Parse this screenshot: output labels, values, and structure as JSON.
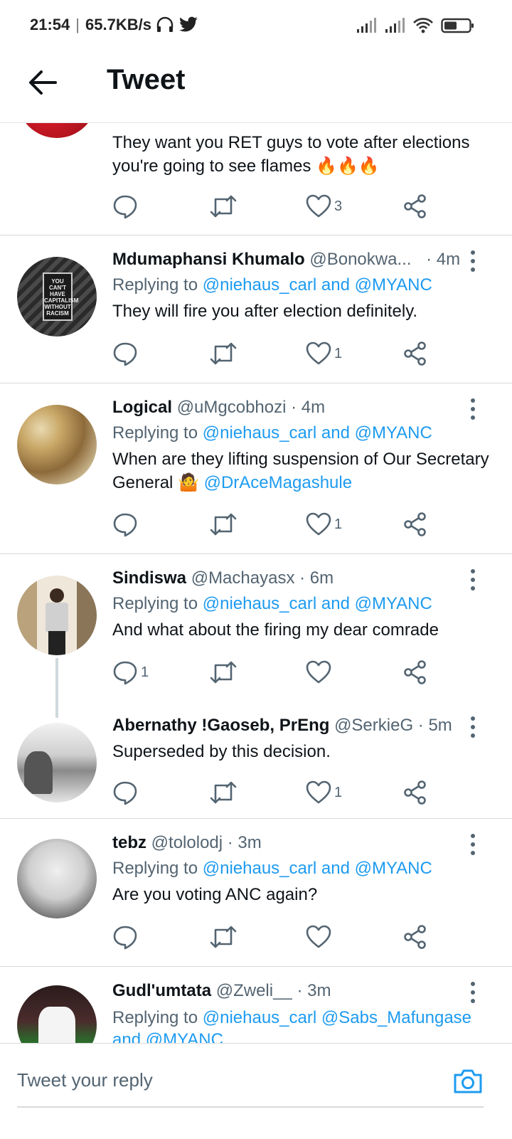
{
  "status": {
    "time": "21:54",
    "speed": "65.7KB/s"
  },
  "header": {
    "title": "Tweet"
  },
  "tweets": [
    {
      "text": "They want you RET guys to vote after elections you're going to see flames 🔥🔥🔥",
      "likes": "3"
    },
    {
      "name": "Mdumaphansi Khumalo",
      "handle": "@Bonokwa...",
      "time": "· 4m",
      "reply_prefix": "Replying to ",
      "reply_to": "@niehaus_carl and @MYANC",
      "text": "They will fire you after election definitely.",
      "likes": "1"
    },
    {
      "name": "Logical",
      "handle": "@uMgcobhozi",
      "time": "· 4m",
      "reply_prefix": "Replying to ",
      "reply_to": "@niehaus_carl and @MYANC",
      "text": "When are they lifting suspension of Our Secretary General 🤷 ",
      "mention": "@DrAceMagashule",
      "likes": "1"
    },
    {
      "name": "Sindiswa",
      "handle": "@Machayasx",
      "time": "· 6m",
      "reply_prefix": "Replying to ",
      "reply_to": "@niehaus_carl and @MYANC",
      "text": "And what about the firing my dear comrade",
      "replies": "1",
      "likes": ""
    },
    {
      "name": "Abernathy !Gaoseb, PrEng",
      "handle": "@SerkieG",
      "time": "· 5m",
      "text": "Superseded by this decision.",
      "likes": "1"
    },
    {
      "name": "tebz",
      "handle": "@tololodj",
      "time": "· 3m",
      "reply_prefix": "Replying to ",
      "reply_to": "@niehaus_carl and @MYANC",
      "text": "Are you voting ANC again?",
      "likes": ""
    },
    {
      "name": "Gudl'umtata",
      "handle": "@Zweli__",
      "time": "· 3m",
      "reply_prefix": "Replying to ",
      "reply_to": "@niehaus_carl @Sabs_Mafungase and @MYANC"
    }
  ],
  "composer": {
    "placeholder": "Tweet your reply"
  },
  "colors": {
    "accent": "#1d9bf0",
    "text": "#0f1419",
    "muted": "#536471"
  }
}
